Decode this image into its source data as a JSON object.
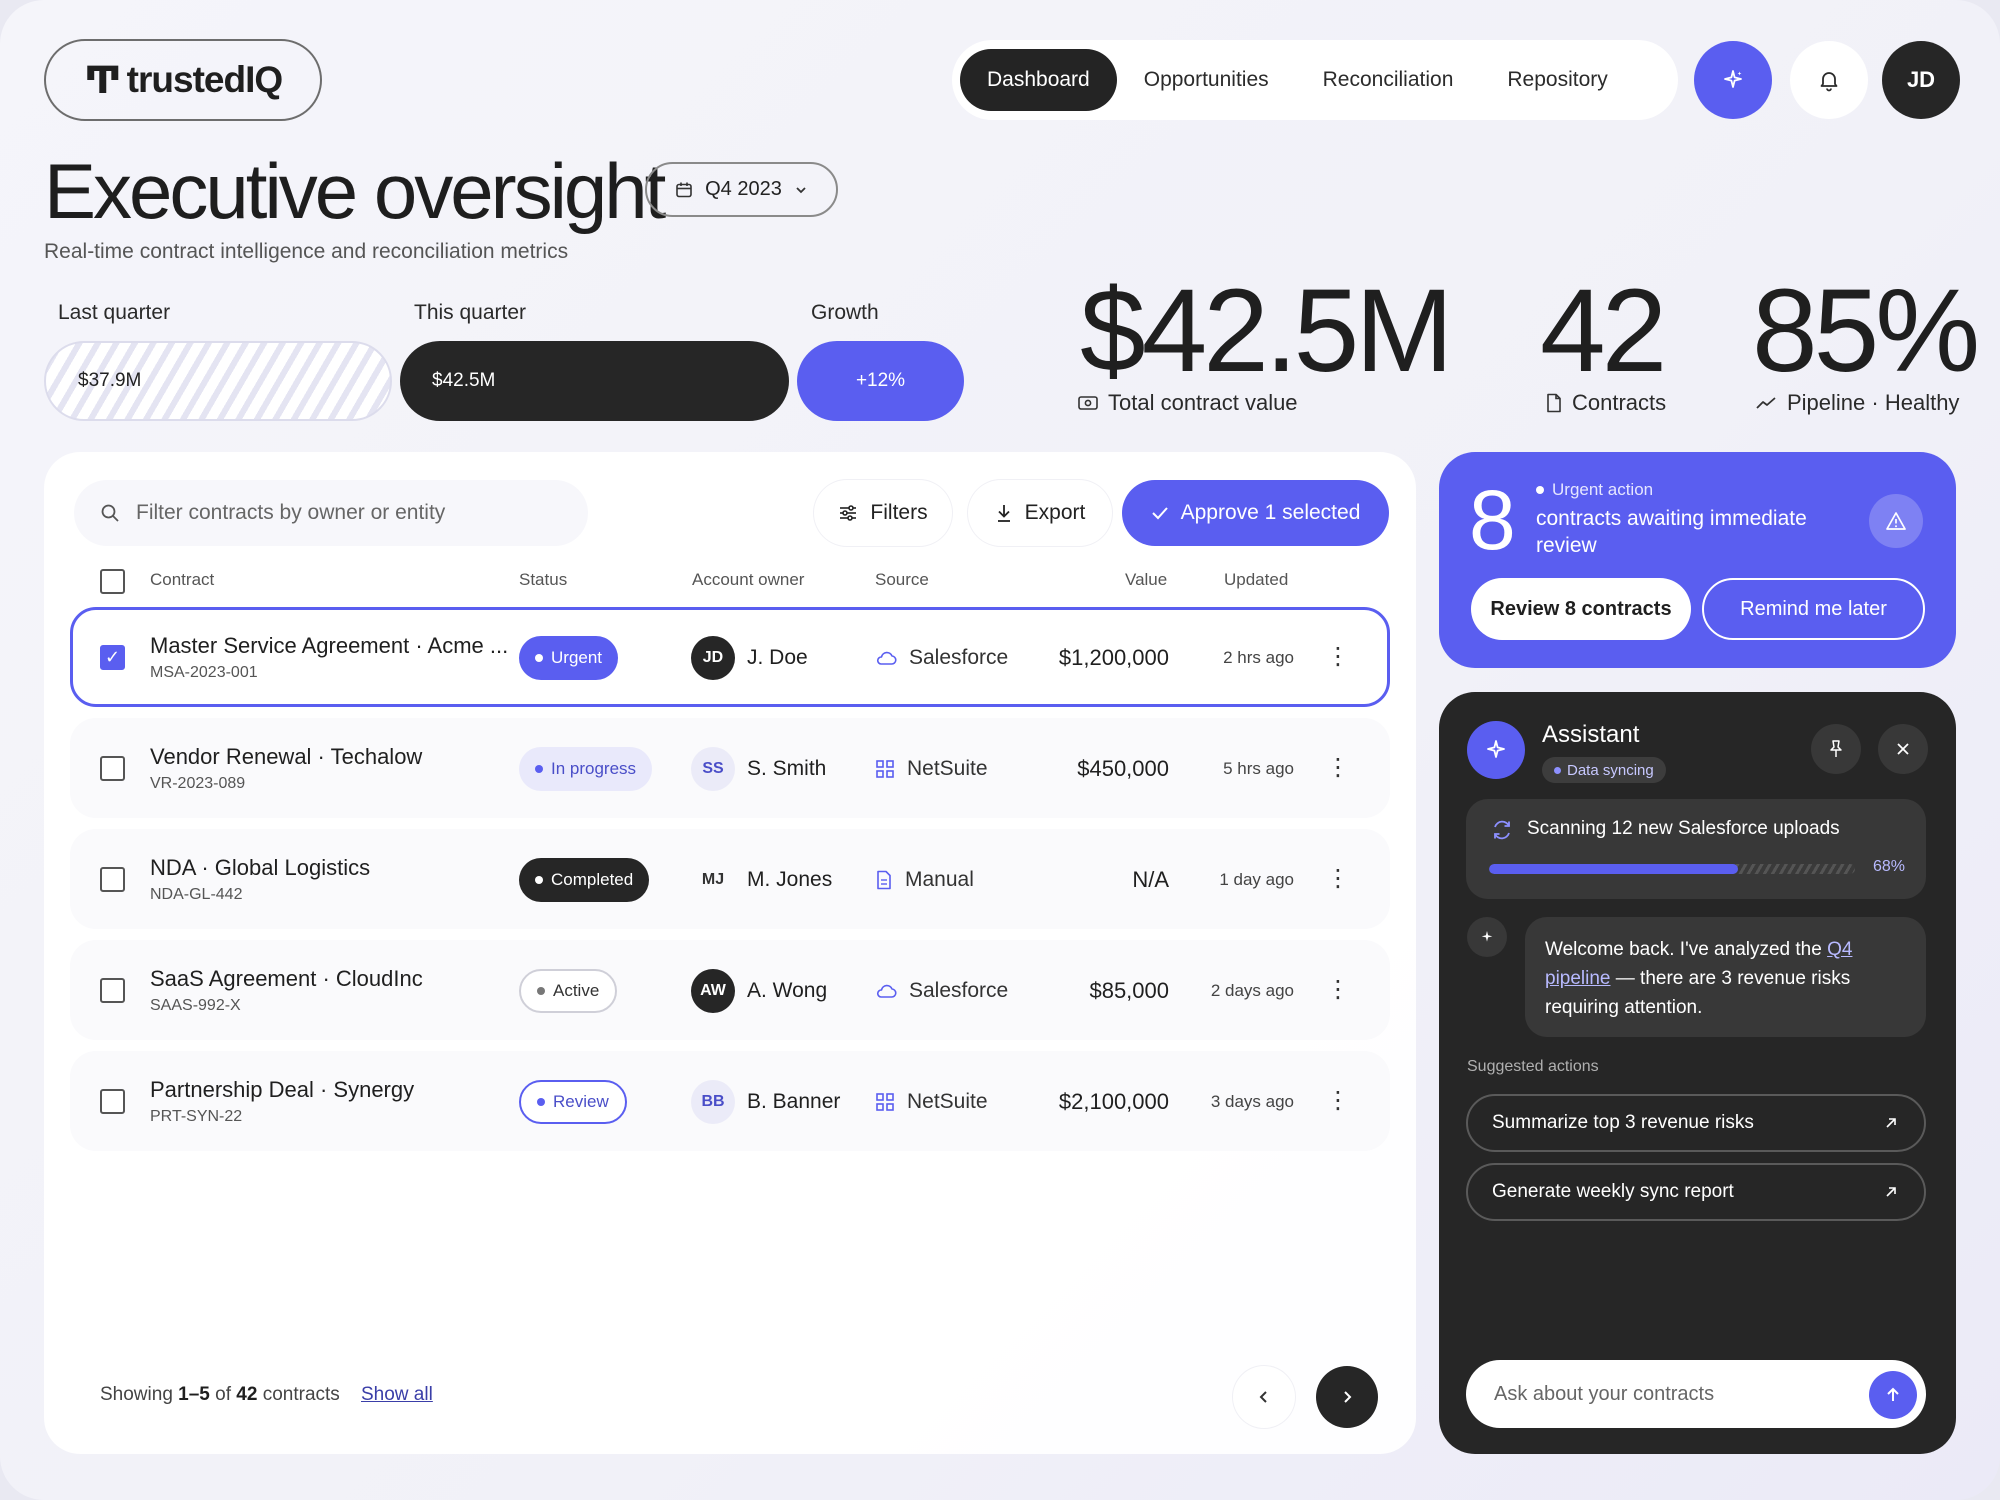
{
  "brand": {
    "logo_text": "trustedIQ",
    "accent": "#5a5ef0",
    "dark": "#262626"
  },
  "nav": {
    "tabs": [
      {
        "label": "Dashboard",
        "active": true
      },
      {
        "label": "Opportunities",
        "active": false
      },
      {
        "label": "Reconciliation",
        "active": false
      },
      {
        "label": "Repository",
        "active": false
      }
    ],
    "user_initials": "JD",
    "icons": [
      "sparkle-icon",
      "bell-icon"
    ]
  },
  "header": {
    "title": "Executive oversight",
    "period": "Q4 2023",
    "subtitle": "Real-time contract intelligence and reconciliation metrics"
  },
  "comparison": {
    "last_label": "Last quarter",
    "last_value": "$37.9M",
    "this_label": "This quarter",
    "this_value": "$42.5M",
    "growth_label": "Growth",
    "growth_value": "+12%"
  },
  "stats": [
    {
      "value": "$42.5M",
      "caption": "Total contract value",
      "icon": "cash-icon"
    },
    {
      "value": "42",
      "caption": "Contracts",
      "icon": "document-icon"
    },
    {
      "value": "85%",
      "caption": "Pipeline · Healthy",
      "icon": "trend-icon"
    }
  ],
  "toolbar": {
    "search_placeholder": "Filter contracts by owner or entity",
    "filters_label": "Filters",
    "export_label": "Export",
    "approve_label": "Approve 1 selected"
  },
  "table": {
    "columns": [
      "Contract",
      "Status",
      "Account owner",
      "Source",
      "Value",
      "Updated"
    ],
    "rows": [
      {
        "name": "Master Service Agreement · Acme ...",
        "id": "MSA-2023-001",
        "status": "Urgent",
        "status_style": "urgent",
        "initials": "JD",
        "owner": "J. Doe",
        "avatar_style": "dark",
        "source": "Salesforce",
        "source_icon": "cloud-icon",
        "value": "$1,200,000",
        "updated": "2 hrs ago",
        "selected": true
      },
      {
        "name": "Vendor Renewal · Techalow",
        "id": "VR-2023-089",
        "status": "In progress",
        "status_style": "progress",
        "initials": "SS",
        "owner": "S. Smith",
        "avatar_style": "light",
        "source": "NetSuite",
        "source_icon": "grid-icon",
        "value": "$450,000",
        "updated": "5 hrs ago",
        "selected": false
      },
      {
        "name": "NDA · Global Logistics",
        "id": "NDA-GL-442",
        "status": "Completed",
        "status_style": "done",
        "initials": "MJ",
        "owner": "M. Jones",
        "avatar_style": "plain",
        "source": "Manual",
        "source_icon": "document-icon",
        "value": "N/A",
        "updated": "1 day ago",
        "selected": false
      },
      {
        "name": "SaaS Agreement · CloudInc",
        "id": "SAAS-992-X",
        "status": "Active",
        "status_style": "active",
        "initials": "AW",
        "owner": "A. Wong",
        "avatar_style": "dark",
        "source": "Salesforce",
        "source_icon": "cloud-icon",
        "value": "$85,000",
        "updated": "2 days ago",
        "selected": false
      },
      {
        "name": "Partnership Deal · Synergy",
        "id": "PRT-SYN-22",
        "status": "Review",
        "status_style": "review",
        "initials": "BB",
        "owner": "B. Banner",
        "avatar_style": "light",
        "source": "NetSuite",
        "source_icon": "grid-icon",
        "value": "$2,100,000",
        "updated": "3 days ago",
        "selected": false
      }
    ]
  },
  "footer": {
    "showing_prefix": "Showing",
    "range": "1–5",
    "of": "of",
    "total": "42",
    "suffix": "contracts",
    "show_all": "Show all"
  },
  "urgent": {
    "count": "8",
    "tag": "Urgent action",
    "text": "contracts awaiting immediate review",
    "primary": "Review 8 contracts",
    "secondary": "Remind me later"
  },
  "assistant": {
    "title": "Assistant",
    "status": "Data syncing",
    "scan_text": "Scanning 12 new Salesforce uploads",
    "scan_progress": 0.68,
    "scan_pct": "68%",
    "message_before": "Welcome back. I've analyzed the ",
    "message_link": "Q4 pipeline",
    "message_after": " — there are 3 revenue risks requiring attention.",
    "suggested_label": "Suggested actions",
    "suggestions": [
      "Summarize top 3 revenue risks",
      "Generate weekly sync report"
    ],
    "input_placeholder": "Ask about your contracts"
  }
}
